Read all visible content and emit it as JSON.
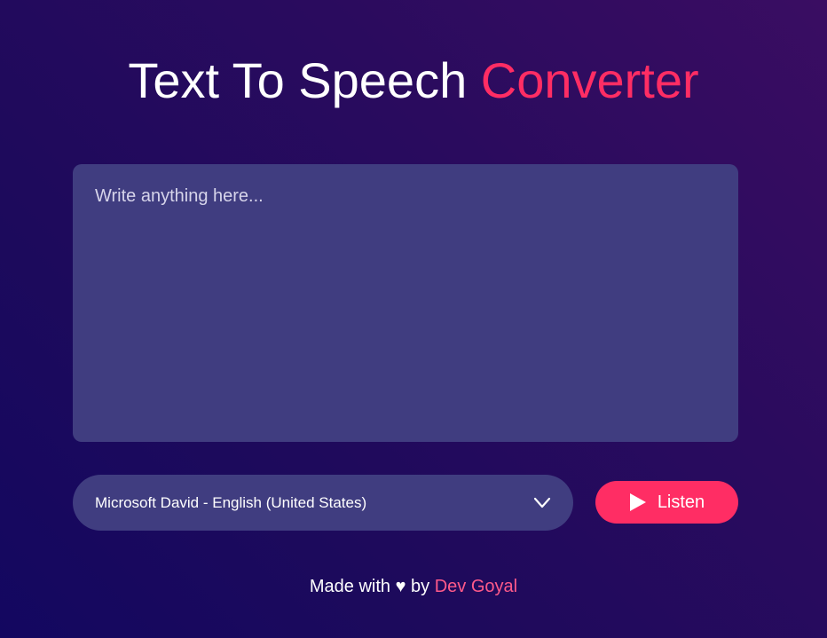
{
  "header": {
    "title_main": "Text To Speech",
    "title_accent": "Converter"
  },
  "editor": {
    "placeholder": "Write anything here...",
    "value": ""
  },
  "voice_select": {
    "selected": "Microsoft David - English (United States)",
    "icon": "chevron-down-icon"
  },
  "listen_button": {
    "label": "Listen",
    "icon": "play-icon"
  },
  "footer": {
    "prefix": "Made with",
    "heart": "♥",
    "by": "by",
    "author": "Dev Goyal"
  },
  "colors": {
    "accent": "#ff2d64",
    "panel": "#403d80",
    "author_link": "#ff5a8a"
  }
}
